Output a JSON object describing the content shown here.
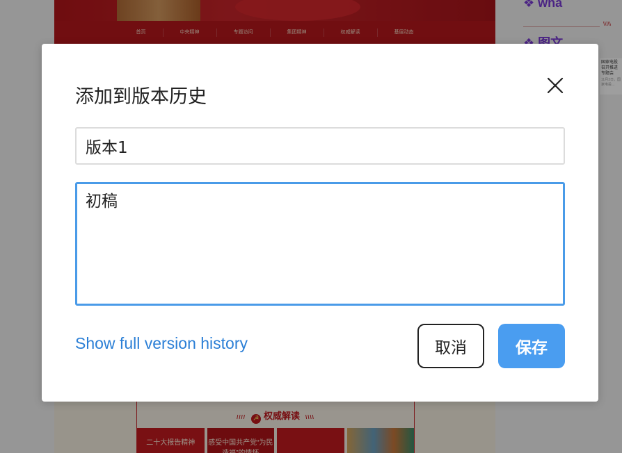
{
  "background": {
    "nav_items": [
      "首页",
      "中央精神",
      "专题访问",
      "集团精神",
      "权威解读",
      "基层动态"
    ],
    "section_title": "权威解读",
    "cards": [
      "二十大报告精神",
      "感受中国共产党“为民造福”的情怀",
      "",
      ""
    ],
    "side_labels": [
      "wha",
      "图文"
    ],
    "side_card_title": "国家电投召开推进专题会",
    "side_card_snippet": "11月3日，国家电投..."
  },
  "dialog": {
    "title": "添加到版本历史",
    "version_name_value": "版本1",
    "description_value": "初稿",
    "history_link": "Show full version history",
    "cancel_label": "取消",
    "save_label": "保存"
  },
  "colors": {
    "accent": "#4a9df0",
    "link": "#2b7fd6",
    "focus_border": "#4a9be8"
  },
  "icons": {
    "close": "close-icon",
    "emblem": "party-emblem-icon",
    "side_diamond": "diamond-icon"
  }
}
